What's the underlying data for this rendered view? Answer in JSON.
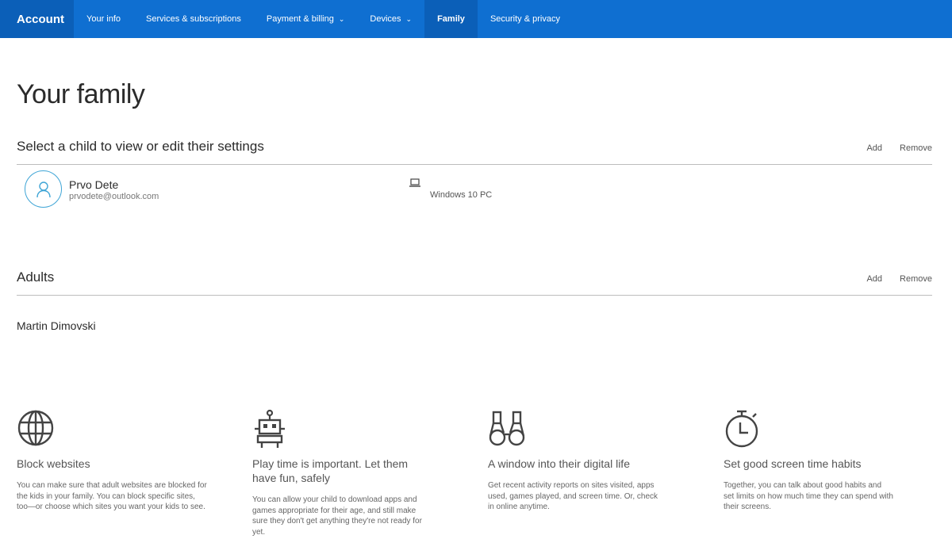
{
  "nav": {
    "brand": "Account",
    "items": [
      {
        "label": "Your info",
        "dropdown": false,
        "active": false
      },
      {
        "label": "Services & subscriptions",
        "dropdown": false,
        "active": false
      },
      {
        "label": "Payment & billing",
        "dropdown": true,
        "active": false
      },
      {
        "label": "Devices",
        "dropdown": true,
        "active": false
      },
      {
        "label": "Family",
        "dropdown": false,
        "active": true
      },
      {
        "label": "Security & privacy",
        "dropdown": false,
        "active": false
      }
    ]
  },
  "page": {
    "title": "Your family"
  },
  "kids": {
    "heading": "Select a child to view or edit their settings",
    "add_label": "Add",
    "remove_label": "Remove",
    "child": {
      "name": "Prvo Dete",
      "email": "prvodete@outlook.com",
      "device_icon": "laptop-icon",
      "device": "Windows 10 PC"
    }
  },
  "adults": {
    "heading": "Adults",
    "add_label": "Add",
    "remove_label": "Remove",
    "members": [
      "Martin Dimovski"
    ]
  },
  "features": [
    {
      "icon": "globe-icon",
      "title": "Block websites",
      "body": "You can make sure that adult websites are blocked for the kids in your family. You can block specific sites, too—or choose which sites you want your kids to see."
    },
    {
      "icon": "robot-icon",
      "title": "Play time is important. Let them have fun, safely",
      "body": "You can allow your child to download apps and games appropriate for their age, and still make sure they don't get anything they're not ready for yet."
    },
    {
      "icon": "binoculars-icon",
      "title": "A window into their digital life",
      "body": "Get recent activity reports on sites visited, apps used, games played, and screen time. Or, check in online anytime."
    },
    {
      "icon": "stopwatch-icon",
      "title": "Set good screen time habits",
      "body": "Together, you can talk about good habits and set limits on how much time they can spend with their screens."
    }
  ],
  "colors": {
    "nav_bg": "#0f6fd1",
    "nav_active_bg": "#0b5fb8",
    "avatar_ring": "#3fa5d6"
  }
}
